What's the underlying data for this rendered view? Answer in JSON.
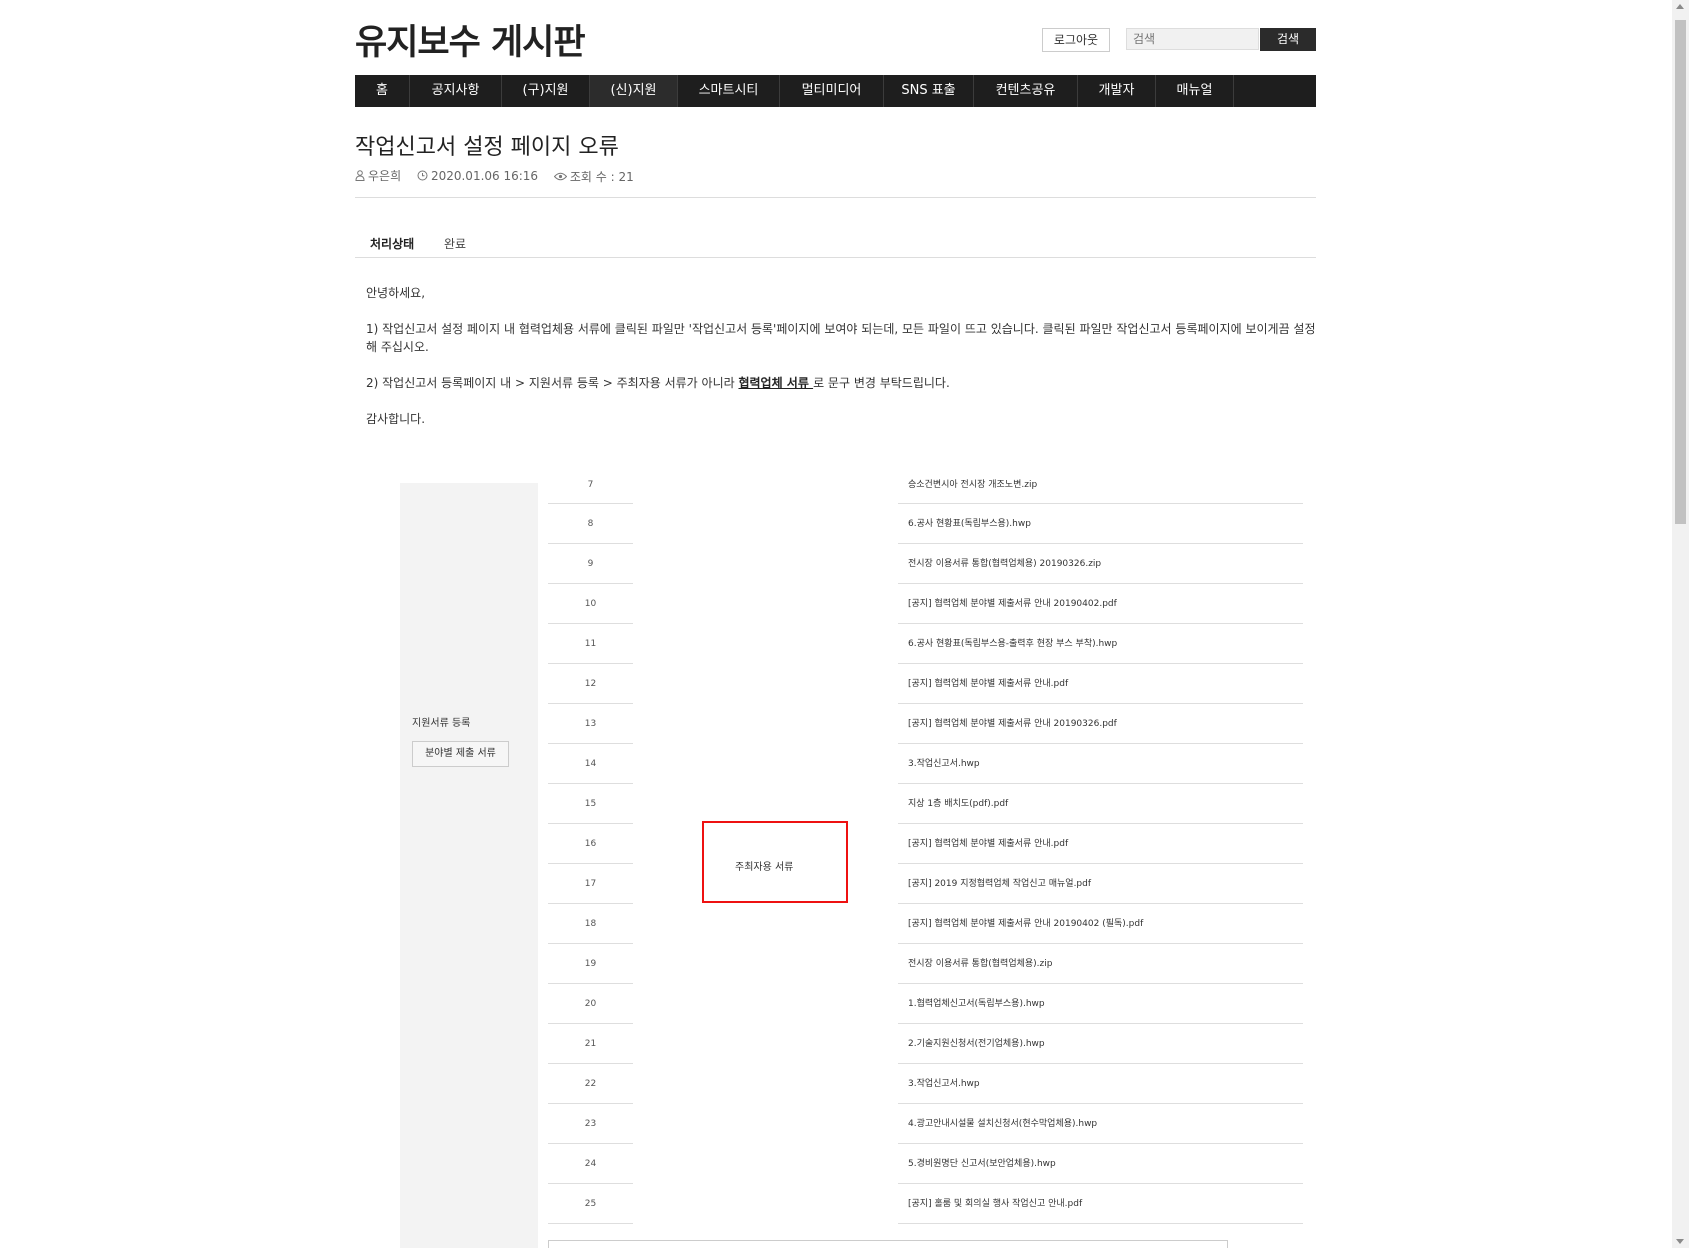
{
  "header": {
    "title": "유지보수 게시판",
    "logout_label": "로그아웃",
    "search_placeholder": "검색",
    "search_button": "검색"
  },
  "nav": {
    "items": [
      {
        "label": "홈"
      },
      {
        "label": "공지사항"
      },
      {
        "label": "(구)지원"
      },
      {
        "label": "(신)지원"
      },
      {
        "label": "스마트시티"
      },
      {
        "label": "멀티미디어"
      },
      {
        "label": "SNS 표출"
      },
      {
        "label": "컨텐츠공유"
      },
      {
        "label": "개발자"
      },
      {
        "label": "매뉴얼"
      }
    ]
  },
  "post": {
    "title": "작업신고서 설정 페이지 오류",
    "author": "우은희",
    "datetime": "2020.01.06 16:16",
    "views": "조회 수 : 21",
    "status_label": "처리상태",
    "status_value": "완료",
    "greeting": "안녕하세요,",
    "para1": "1) 작업신고서 설정 페이지 내 협력업체용 서류에 클릭된 파일만 '작업신고서 등록'페이지에 보여야 되는데, 모든 파일이 뜨고 있습니다. 클릭된 파일만 작업신고서 등록페이지에 보이게끔 설정해 주십시오.",
    "para2_before": "2) 작업신고서 등록페이지 내 > 지원서류 등록 > 주최자용 서류가 아니라 ",
    "para2_link": "협력업체 서류 ",
    "para2_after": "로 문구 변경 부탁드립니다.",
    "closing": "감사합니다."
  },
  "screenshot": {
    "registration_label": "지원서류 등록",
    "field_button": "분야별 제출 서류",
    "sponsor_docs_label": "주최자용 서류",
    "rows": [
      {
        "num": "7",
        "file": "승소건변시아 전시장 개조노변.zip"
      },
      {
        "num": "8",
        "file": "6.공사 현황표(독립부스용).hwp"
      },
      {
        "num": "9",
        "file": "전시장 이용서류 통합(협력업체용) 20190326.zip"
      },
      {
        "num": "10",
        "file": "[공지] 협력업체 분야별 제출서류 안내 20190402.pdf"
      },
      {
        "num": "11",
        "file": "6.공사 현황표(독립부스용-출력후 현장 부스 부착).hwp"
      },
      {
        "num": "12",
        "file": "[공지] 협력업체 분야별 제출서류 안내.pdf"
      },
      {
        "num": "13",
        "file": "[공지] 협력업체 분야별 제출서류 안내 20190326.pdf"
      },
      {
        "num": "14",
        "file": "3.작업신고서.hwp"
      },
      {
        "num": "15",
        "file": "지상 1층 배치도(pdf).pdf"
      },
      {
        "num": "16",
        "file": "[공지] 협력업체 분야별 제출서류 안내.pdf"
      },
      {
        "num": "17",
        "file": "[공지] 2019 지정협력업체 작업신고 매뉴얼.pdf"
      },
      {
        "num": "18",
        "file": "[공지] 협력업체 분야별 제출서류 안내 20190402 (필독).pdf"
      },
      {
        "num": "19",
        "file": "전시장 이용서류 통합(협력업체용).zip"
      },
      {
        "num": "20",
        "file": "1.협력업체신고서(독립부스용).hwp"
      },
      {
        "num": "21",
        "file": "2.기술지원신청서(전기업체용).hwp"
      },
      {
        "num": "22",
        "file": "3.작업신고서.hwp"
      },
      {
        "num": "23",
        "file": "4.광고안내시설물 설치신청서(현수막업체용).hwp"
      },
      {
        "num": "24",
        "file": "5.경비원명단 신고서(보안업체용).hwp"
      },
      {
        "num": "25",
        "file": "[공지] 홀룸 및 회의실 행사 작업신고 안내.pdf"
      }
    ]
  },
  "colors": {
    "nav_bg": "#1e1e1e",
    "search_button_bg": "#2b2b2b",
    "highlight": "#ee1111"
  }
}
